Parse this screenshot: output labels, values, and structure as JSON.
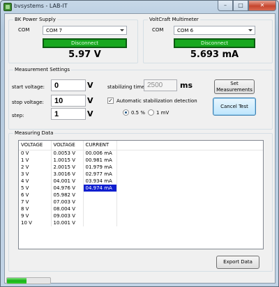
{
  "window": {
    "title": "bvsystems - LAB-IT",
    "minimize": "–",
    "maximize": "□",
    "close": "✕"
  },
  "power_supply": {
    "title": "BK Power Supply",
    "com_label": "COM",
    "com_value": "COM 7",
    "disconnect_label": "Disconnect",
    "reading": "5.97 V"
  },
  "multimeter": {
    "title": "VoltCraft Multimeter",
    "com_label": "COM",
    "com_value": "COM 6",
    "disconnect_label": "Disconnect",
    "reading": "5.693 mA"
  },
  "settings": {
    "title": "Measurement Settings",
    "start_label": "start voltage:",
    "start_value": "0",
    "stop_label": "stop voltage:",
    "stop_value": "10",
    "step_label": "step:",
    "step_value": "1",
    "unit_v": "V",
    "stabilizing_label": "stabilizing time:",
    "stabilizing_value": "2500",
    "unit_ms": "ms",
    "auto_label": "Automatic stabilization detection",
    "auto_checked": "✓",
    "radio_pct_label": "0.5 %",
    "radio_mv_label": "1 mV",
    "set_button": "Set Measurements",
    "cancel_button": "Cancel Test"
  },
  "measuring": {
    "title": "Measuring Data",
    "columns": [
      "VOLTAGE",
      "VOLTAGE",
      "CURRENT"
    ],
    "rows": [
      [
        "0 V",
        "0.0053 V",
        "00.006 mA"
      ],
      [
        "1 V",
        "1.0015 V",
        "00.981 mA"
      ],
      [
        "2 V",
        "2.0015 V",
        "01.979 mA"
      ],
      [
        "3 V",
        "3.0016 V",
        "02.977 mA"
      ],
      [
        "4 V",
        "04.001 V",
        "03.934 mA"
      ],
      [
        "5 V",
        "04.976 V",
        "04.974 mA"
      ],
      [
        "6 V",
        "05.982 V",
        ""
      ],
      [
        "7 V",
        "07.003 V",
        ""
      ],
      [
        "8 V",
        "08.004 V",
        ""
      ],
      [
        "9 V",
        "09.003 V",
        ""
      ],
      [
        "10 V",
        "10.001 V",
        ""
      ]
    ],
    "export_button": "Export Data"
  },
  "status": {
    "progress": 0.45
  }
}
